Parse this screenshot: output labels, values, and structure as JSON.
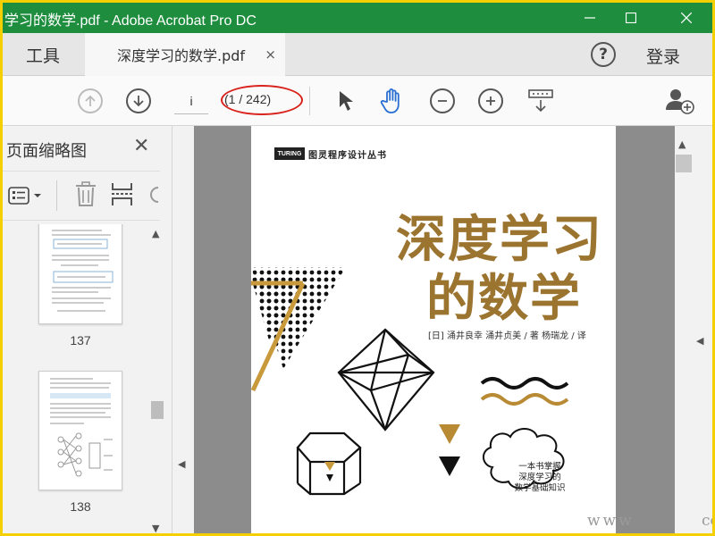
{
  "window": {
    "title": "学习的数学.pdf - Adobe Acrobat Pro DC"
  },
  "tabs": {
    "tools_label": "工具",
    "doc_label": "深度学习的数学.pdf",
    "close_glyph": "×"
  },
  "header": {
    "help_glyph": "?",
    "login_label": "登录"
  },
  "toolbar": {
    "page_input_value": "i",
    "page_count": "(1 / 242)"
  },
  "left_panel": {
    "title": "页面缩略图",
    "close_glyph": "✕",
    "thumbnails": [
      {
        "label": "137"
      },
      {
        "label": "138"
      }
    ]
  },
  "cover": {
    "publisher_logo": "TURING",
    "series": "图灵程序设计丛书",
    "title_line1": "深度学习",
    "title_line2": "的数学",
    "authors": "[日] 涌井良幸  涌井贞美 / 著    杨瑞龙 / 译",
    "badge_line1": "一本书掌握",
    "badge_line2": "深度学习的",
    "badge_line3": "数学基础知识"
  },
  "watermark": {
    "left": "www",
    "right": "com"
  },
  "colors": {
    "titlebar": "#1e8e3e",
    "cover_title": "#9b7430",
    "highlight": "#d9221c",
    "frame": "#f4d000"
  }
}
